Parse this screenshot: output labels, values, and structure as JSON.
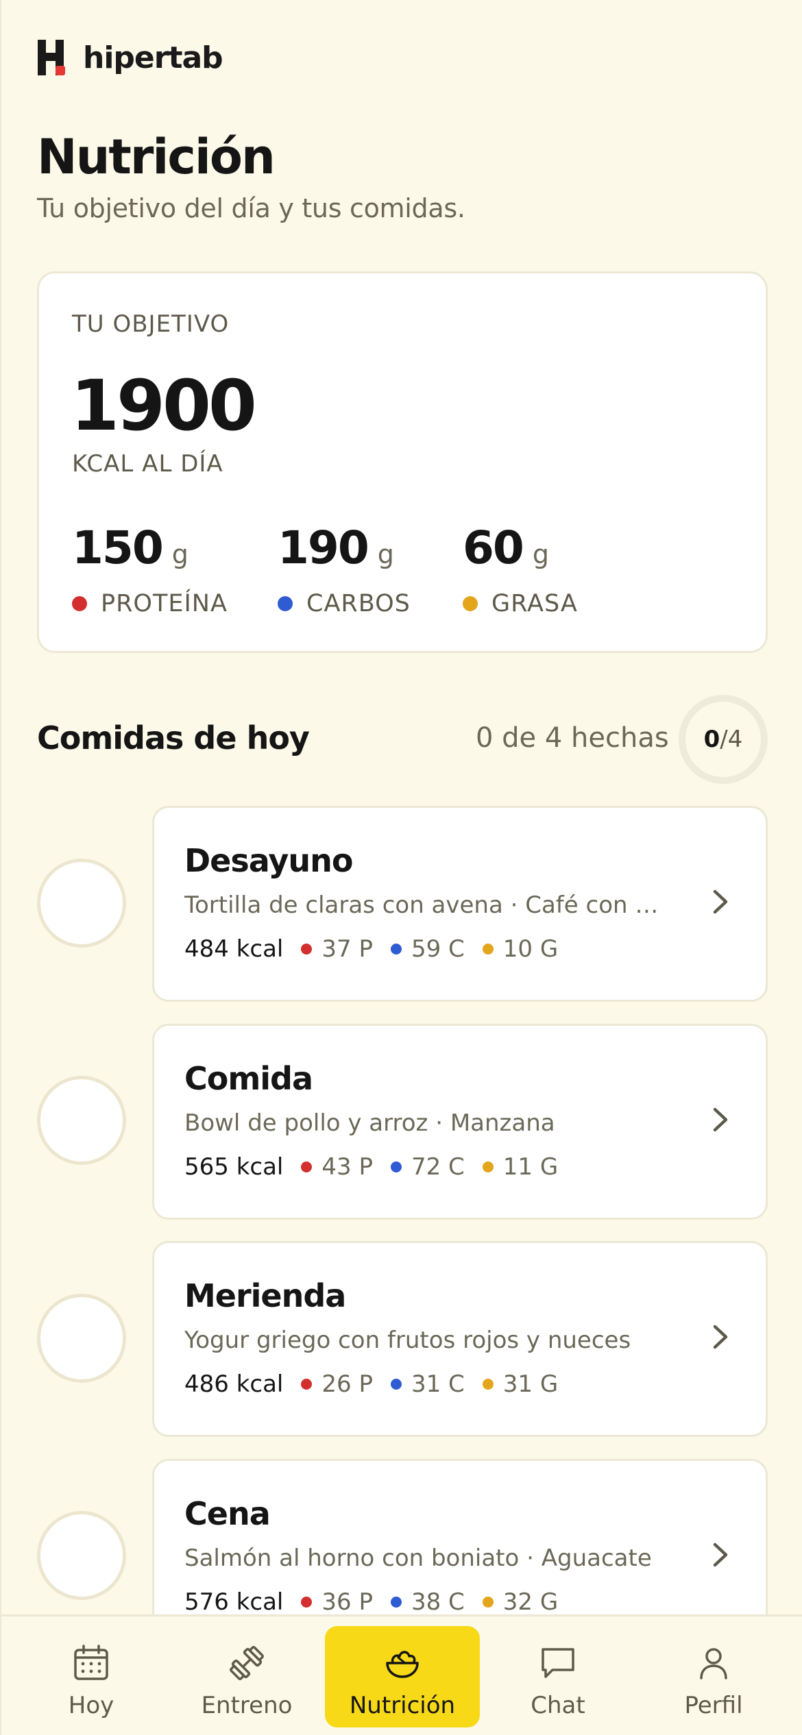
{
  "app": {
    "logo_text": "hipertab"
  },
  "header": {
    "title": "Nutrición",
    "subtitle": "Tu objetivo del día y tus comidas."
  },
  "goal": {
    "label": "TU OBJETIVO",
    "kcal": "1900",
    "kcal_unit": "KCAL AL DÍA",
    "macros": [
      {
        "value": "150",
        "unit": "g",
        "label": "PROTEÍNA",
        "color": "#d32f2f"
      },
      {
        "value": "190",
        "unit": "g",
        "label": "CARBOS",
        "color": "#2f5bd3"
      },
      {
        "value": "60",
        "unit": "g",
        "label": "GRASA",
        "color": "#e3a51c"
      }
    ]
  },
  "meals_section": {
    "title": "Comidas de hoy",
    "count_text": "0 de 4 hechas",
    "done": "0",
    "total": "/4",
    "progress_fraction": 0
  },
  "meals": [
    {
      "name": "Desayuno",
      "description": "Tortilla de claras con avena · Café con leche",
      "kcal": "484 kcal",
      "p": "37 P",
      "c": "59 C",
      "g": "10 G"
    },
    {
      "name": "Comida",
      "description": "Bowl de pollo y arroz · Manzana",
      "kcal": "565 kcal",
      "p": "43 P",
      "c": "72 C",
      "g": "11 G"
    },
    {
      "name": "Merienda",
      "description": "Yogur griego con frutos rojos y nueces",
      "kcal": "486 kcal",
      "p": "26 P",
      "c": "31 C",
      "g": "31 G"
    },
    {
      "name": "Cena",
      "description": "Salmón al horno con boniato · Aguacate",
      "kcal": "576 kcal",
      "p": "36 P",
      "c": "38 C",
      "g": "32 G"
    }
  ],
  "nav": {
    "items": [
      {
        "label": "Hoy",
        "icon": "calendar-icon"
      },
      {
        "label": "Entreno",
        "icon": "dumbbell-icon"
      },
      {
        "label": "Nutrición",
        "icon": "salad-bowl-icon",
        "active": true
      },
      {
        "label": "Chat",
        "icon": "chat-bubble-icon"
      },
      {
        "label": "Perfil",
        "icon": "user-icon"
      }
    ]
  },
  "colors": {
    "background": "#fdf9e9",
    "accent": "#f7d917",
    "protein": "#d32f2f",
    "carbs": "#2f5bd3",
    "fat": "#e3a51c",
    "logo_dot": "#e53935"
  }
}
